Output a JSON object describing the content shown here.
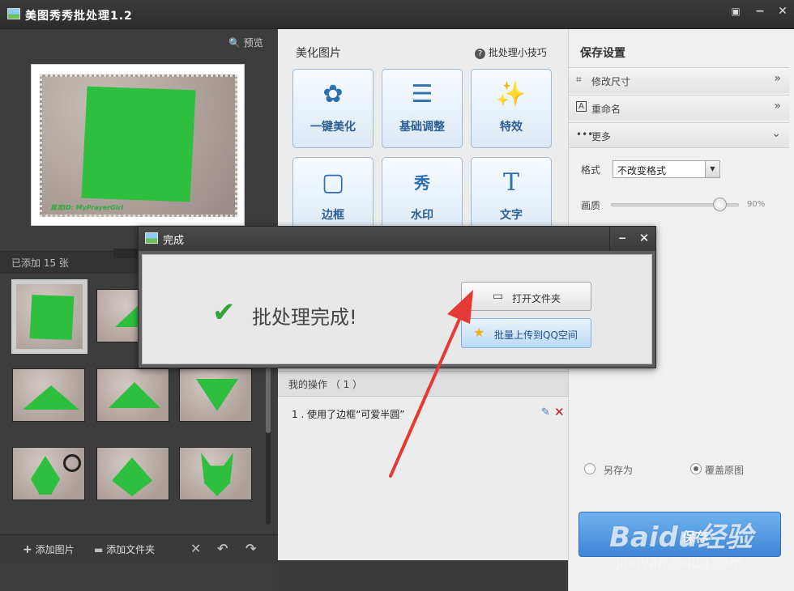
{
  "window": {
    "title": "美图秀秀批处理1.2",
    "feedback_icon": "chat-icon",
    "min_icon": "−",
    "close_icon": "✕"
  },
  "left": {
    "preview_label": "预览",
    "preview_icon": "🔍",
    "preview_watermark": "首发ID: MyPrayerGirl",
    "added_count": "已添加 15 张",
    "add_image": "添加图片",
    "add_folder": "添加文件夹",
    "add_image_icon": "+",
    "add_folder_icon": "▬",
    "delete_icon": "✕",
    "rotate_left_icon": "↶",
    "rotate_right_icon": "↷"
  },
  "middle": {
    "beautify_title": "美化图片",
    "tips_icon": "?",
    "tips": "批处理小技巧",
    "tools": [
      {
        "label": "一键美化",
        "icon": "✿"
      },
      {
        "label": "基础调整",
        "icon": "☰"
      },
      {
        "label": "特效",
        "icon": "✨"
      },
      {
        "label": "边框",
        "icon": "▢"
      },
      {
        "label": "水印",
        "icon": "秀"
      },
      {
        "label": "文字",
        "icon": "T"
      }
    ],
    "ops_title": "我的操作 （ 1 ）",
    "ops_items": [
      "1 . 使用了边框“可爱半圆”"
    ],
    "edit_icon": "✎",
    "delete_icon": "✕"
  },
  "right": {
    "save_settings": "保存设置",
    "accordions": [
      {
        "label": "修改尺寸",
        "icon": "⌗",
        "chevron": "»"
      },
      {
        "label": "重命名",
        "icon": "A",
        "chevron": "»"
      },
      {
        "label": "更多",
        "icon": "•••",
        "chevron": "⌄"
      }
    ],
    "format_label": "格式",
    "format_value": "不改变格式",
    "format_arrow": "▼",
    "quality_label": "画质",
    "quality_value": "90%",
    "quality_level": 0.9,
    "save_as": "另存为",
    "overwrite": "覆盖原图",
    "selected_option": "覆盖原图",
    "save_button": "保存"
  },
  "dialog": {
    "title": "完成",
    "min_icon": "−",
    "close_icon": "✕",
    "check_icon": "✔",
    "message": "批处理完成!",
    "open_folder": "打开文件夹",
    "open_folder_icon": "▭",
    "upload_qq": "批量上传到QQ空间",
    "upload_qq_icon": "★"
  },
  "watermark": {
    "logo": "Baidu经验",
    "url": "jingyan.baidu.com"
  },
  "colors": {
    "accent": "#2f6fb3",
    "arrow": "#e53935",
    "check": "#34a43a",
    "paper": "#2fbf3e"
  }
}
